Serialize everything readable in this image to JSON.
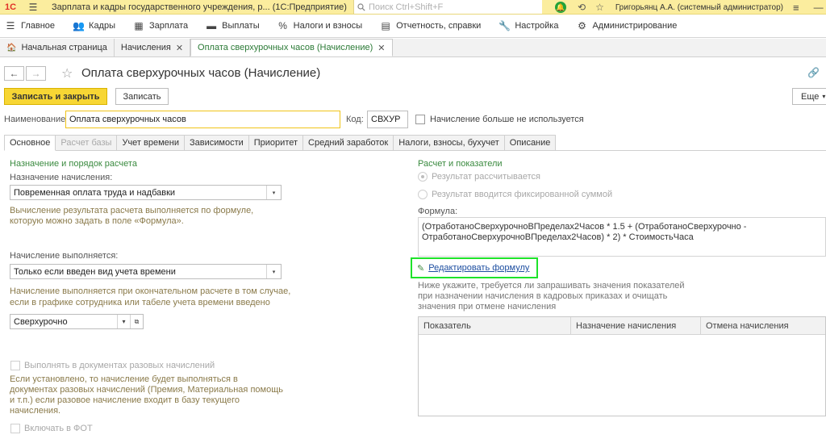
{
  "window": {
    "logo": "1С",
    "title": "Зарплата и кадры государственного учреждения, р...  (1С:Предприятие)",
    "search_placeholder": "Поиск Ctrl+Shift+F",
    "user": "Григорьянц А.А. (системный администратор)"
  },
  "sections": [
    {
      "icon": "menu-icon",
      "label": "Главное"
    },
    {
      "icon": "people-icon",
      "label": "Кадры"
    },
    {
      "icon": "calculator-icon",
      "label": "Зарплата"
    },
    {
      "icon": "wallet-icon",
      "label": "Выплаты"
    },
    {
      "icon": "percent-icon",
      "label": "Налоги и взносы"
    },
    {
      "icon": "report-icon",
      "label": "Отчетность, справки"
    },
    {
      "icon": "wrench-icon",
      "label": "Настройка"
    },
    {
      "icon": "gear-icon",
      "label": "Администрирование"
    }
  ],
  "open_tabs": [
    {
      "label": "Начальная страница"
    },
    {
      "label": "Начисления"
    },
    {
      "label": "Оплата сверхурочных часов (Начисление)"
    }
  ],
  "form": {
    "title": "Оплата сверхурочных часов (Начисление)",
    "save_close": "Записать и закрыть",
    "save": "Записать",
    "more": "Еще",
    "name_label": "Наименование:",
    "name_value": "Оплата сверхурочных часов",
    "code_label": "Код:",
    "code_value": "СВХУР",
    "not_used_label": "Начисление больше не используется"
  },
  "form_tabs": [
    "Основное",
    "Расчет базы",
    "Учет времени",
    "Зависимости",
    "Приоритет",
    "Средний заработок",
    "Налоги, взносы, бухучет",
    "Описание"
  ],
  "left": {
    "group_title": "Назначение и порядок расчета",
    "purpose_label": "Назначение начисления:",
    "purpose_value": "Повременная оплата труда и надбавки",
    "purpose_hint1": "Вычисление результата расчета выполняется по формуле,",
    "purpose_hint2": "которую можно задать в поле «Формула».",
    "executed_label": "Начисление выполняется:",
    "executed_value": "Только если введен вид учета времени",
    "executed_hint1": "Начисление выполняется при окончательном расчете в том случае,",
    "executed_hint2": "если в графике сотрудника или табеле учета времени введено",
    "timetype_value": "Сверхурочно",
    "onetime_label": "Выполнять в документах разовых начислений",
    "onetime_hint1": "Если установлено, то начисление будет выполняться в",
    "onetime_hint2": "документах разовых начислений (Премия, Материальная помощь",
    "onetime_hint3": "и т.п.) если разовое начисление входит в базу текущего",
    "onetime_hint4": "начисления.",
    "fot_label": "Включать в ФОТ"
  },
  "right": {
    "group_title": "Расчет и показатели",
    "radio1": "Результат рассчитывается",
    "radio2": "Результат вводится фиксированной суммой",
    "formula_label": "Формула:",
    "formula_line1": "(ОтработаноСверхурочноВПределах2Часов * 1.5 + (ОтработаноСверхурочно -",
    "formula_line2": "ОтработаноСверхурочноВПределах2Часов) * 2) * СтоимостьЧаса",
    "edit_formula": "Редактировать формулу",
    "hint1": "Ниже укажите, требуется ли запрашивать значения показателей",
    "hint2": "при назначении начисления в кадровых приказах и очищать",
    "hint3": "значения при отмене начисления",
    "table_headers": [
      "Показатель",
      "Назначение начисления",
      "Отмена начисления"
    ]
  }
}
